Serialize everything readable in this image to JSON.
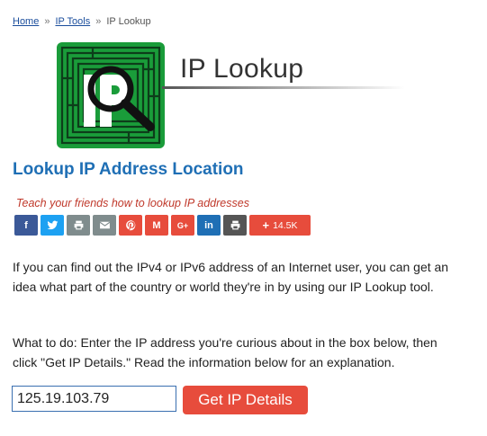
{
  "breadcrumb": {
    "home": "Home",
    "tools": "IP Tools",
    "separator": "»",
    "current": "IP Lookup"
  },
  "header": {
    "tool_title": "IP Lookup",
    "logo_icon": "ip-magnifier-maze-icon"
  },
  "page_title": "Lookup IP Address Location",
  "share": {
    "tagline": "Teach your friends how to lookup IP addresses",
    "buttons": [
      {
        "icon": "facebook-icon",
        "glyph": "f",
        "color": "#3b5998"
      },
      {
        "icon": "twitter-icon",
        "glyph": "t",
        "color": "#1da1f2"
      },
      {
        "icon": "print-icon",
        "glyph": "⎙",
        "color": "#7f8c8d"
      },
      {
        "icon": "email-icon",
        "glyph": "✉",
        "color": "#7f8c8d"
      },
      {
        "icon": "pinterest-icon",
        "glyph": "P",
        "color": "#e74c3c"
      },
      {
        "icon": "gmail-icon",
        "glyph": "M",
        "color": "#e74c3c"
      },
      {
        "icon": "google-plus-icon",
        "glyph": "G+",
        "color": "#e74c3c"
      },
      {
        "icon": "linkedin-icon",
        "glyph": "in",
        "color": "#1f6fb5"
      },
      {
        "icon": "printfriendly-icon",
        "glyph": "⎙",
        "color": "#555555"
      }
    ],
    "count": "14.5K"
  },
  "intro": "If you can find out the IPv4 or IPv6 address of an Internet user, you can get an idea what part of the country or world they're in by using our IP Lookup tool.",
  "instructions": "What to do: Enter the IP address you're curious about in the box below, then click \"Get IP Details.\" Read the information below for an explanation.",
  "form": {
    "ip_value": "125.19.103.79",
    "submit_label": "Get IP Details"
  },
  "colors": {
    "accent_blue": "#1f6fb5",
    "accent_red": "#e74c3c",
    "logo_green": "#1a9c3a"
  }
}
